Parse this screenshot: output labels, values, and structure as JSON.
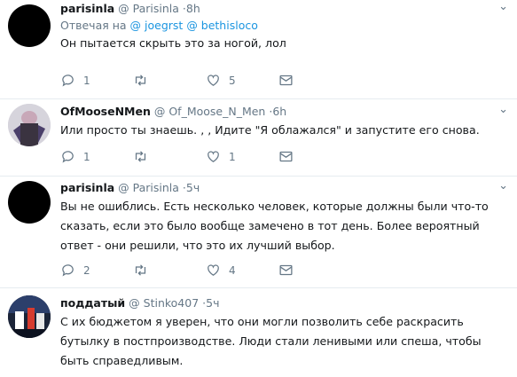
{
  "tweets": [
    {
      "name": "parisinla",
      "handle": "@ Parisinla",
      "time": "8h",
      "reply_prefix": "Отвечая на",
      "reply_to": [
        "@ joegrst",
        "@ bethisloco"
      ],
      "text": "Он пытается скрыть это за ногой, лол",
      "replies": "1",
      "retweets": "",
      "likes": "5"
    },
    {
      "name": "OfMooseNMen",
      "handle": "@ Of_Moose_N_Men",
      "time": "6h",
      "text": "Или просто ты знаешь. , , Идите \"Я облажался\" и запустите его снова.",
      "replies": "1",
      "retweets": "",
      "likes": "1"
    },
    {
      "name": "parisinla",
      "handle": "@ Parisinla",
      "time": "5ч",
      "text": "Вы не ошиблись. Есть несколько человек, которые должны были что-то сказать, если это было вообще замечено в тот день. Более вероятный ответ - они решили, что это их лучший выбор.",
      "replies": "2",
      "retweets": "",
      "likes": "4"
    },
    {
      "name": "поддатый",
      "handle": "@ Stinko407",
      "time": "5ч",
      "text": "С их бюджетом я уверен, что они могли позволить себе раскрасить бутылку в постпроизводстве. Люди стали ленивыми или спеша, чтобы быть справедливым."
    }
  ],
  "separator": "·",
  "icons": [
    "reply-icon",
    "retweet-icon",
    "like-icon",
    "direct-message-icon",
    "chevron-down-icon"
  ]
}
